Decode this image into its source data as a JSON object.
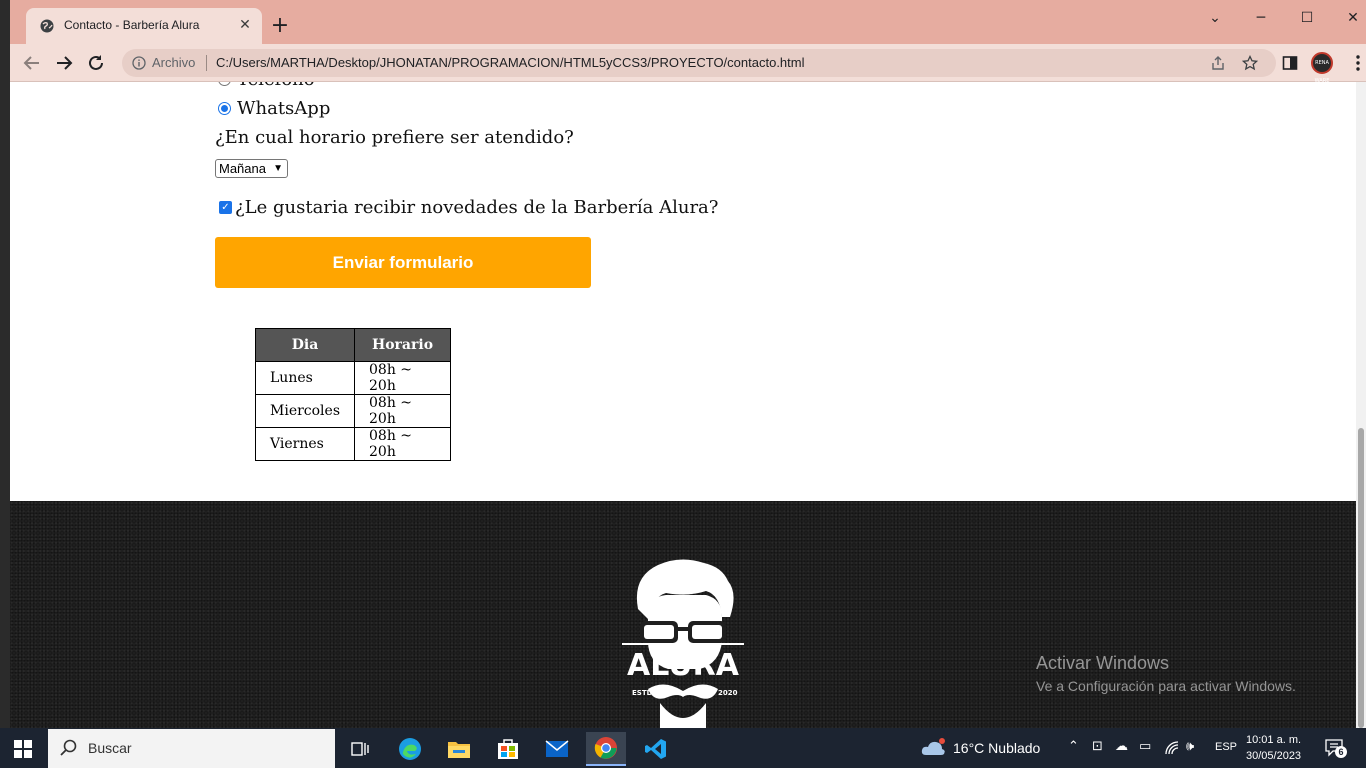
{
  "browser": {
    "tab_title": "Contacto - Barbería Alura",
    "tab_close": "✕",
    "new_tab": "+",
    "omnibox_label": "Archivo",
    "url": "C:/Users/MARTHA/Desktop/JHONATAN/PROGRAMACION/HTML5yCCS3/PROYECTO/contacto.html",
    "window_controls": {
      "menu": "⌄",
      "minimize": "─",
      "maximize": "☐",
      "close": "✕"
    },
    "profile_label": "RENA WARE"
  },
  "form": {
    "radio_partial_label": "Teléfono",
    "radio_whatsapp_label": "WhatsApp",
    "schedule_question": "¿En cual horario prefiere ser atendido?",
    "schedule_selected": "Mañana",
    "newsletter_label": "¿Le gustaria recibir novedades de la Barbería Alura?",
    "submit_label": "Enviar formulario"
  },
  "hours_table": {
    "headers": [
      "Dia",
      "Horario"
    ],
    "rows": [
      [
        "Lunes",
        "08h ~ 20h"
      ],
      [
        "Miercoles",
        "08h ~ 20h"
      ],
      [
        "Viernes",
        "08h ~ 20h"
      ]
    ]
  },
  "footer": {
    "logo_text": "ALURA",
    "logo_estd": "ESTD",
    "logo_year": "2020"
  },
  "watermark": {
    "title": "Activar Windows",
    "subtitle": "Ve a Configuración para activar Windows."
  },
  "taskbar": {
    "search_placeholder": "Buscar",
    "weather": "16°C  Nublado",
    "language": "ESP",
    "time": "10:01 a. m.",
    "date": "30/05/2023",
    "notifications_count": "6"
  },
  "colors": {
    "titlebar": "#e6aca0",
    "accent_button": "#ffa500",
    "table_header": "#555555",
    "footer_bg": "#1f1f1f",
    "taskbar": "#1c2431"
  }
}
